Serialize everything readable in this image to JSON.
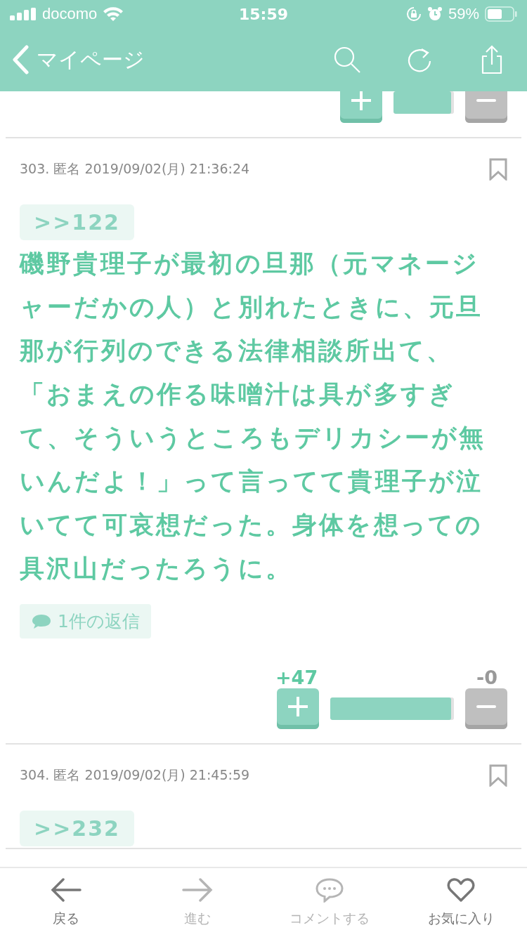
{
  "status_bar": {
    "carrier": "docomo",
    "time": "15:59",
    "battery": "59%"
  },
  "nav": {
    "back_label": "マイページ"
  },
  "posts": [
    {
      "kind": "votes_only",
      "votes": {
        "level": 1
      }
    },
    {
      "kind": "post",
      "header": "303. 匿名 2019/09/02(月) 21:36:24",
      "reply_to": ">>122",
      "body": [
        "磯野貴理子が最初の旦那（元マネージャーだかの人）と別れたときに、元旦那が行列のできる法律相談所出て、",
        "「おまえの作る味噌汁は具が多すぎて、そういうところもデリカシーが無いんだよ！」って言ってて貴理子が泣いてて可哀想だった。身体を想っての具沢山だったろうに。"
      ],
      "replies": "1件の返信",
      "votes": {
        "plus": "+47",
        "minus": "-0",
        "level": 1
      }
    },
    {
      "kind": "post",
      "header": "304. 匿名 2019/09/02(月) 21:45:59",
      "reply_to": ">>232"
    }
  ],
  "tab_bar": [
    {
      "kind": "back",
      "label": "戻る",
      "disabled": false
    },
    {
      "kind": "forward",
      "label": "進む",
      "disabled": true
    },
    {
      "kind": "comment",
      "label": "コメントする",
      "disabled": true
    },
    {
      "kind": "favorite",
      "label": "お気に入り",
      "disabled": false
    }
  ]
}
